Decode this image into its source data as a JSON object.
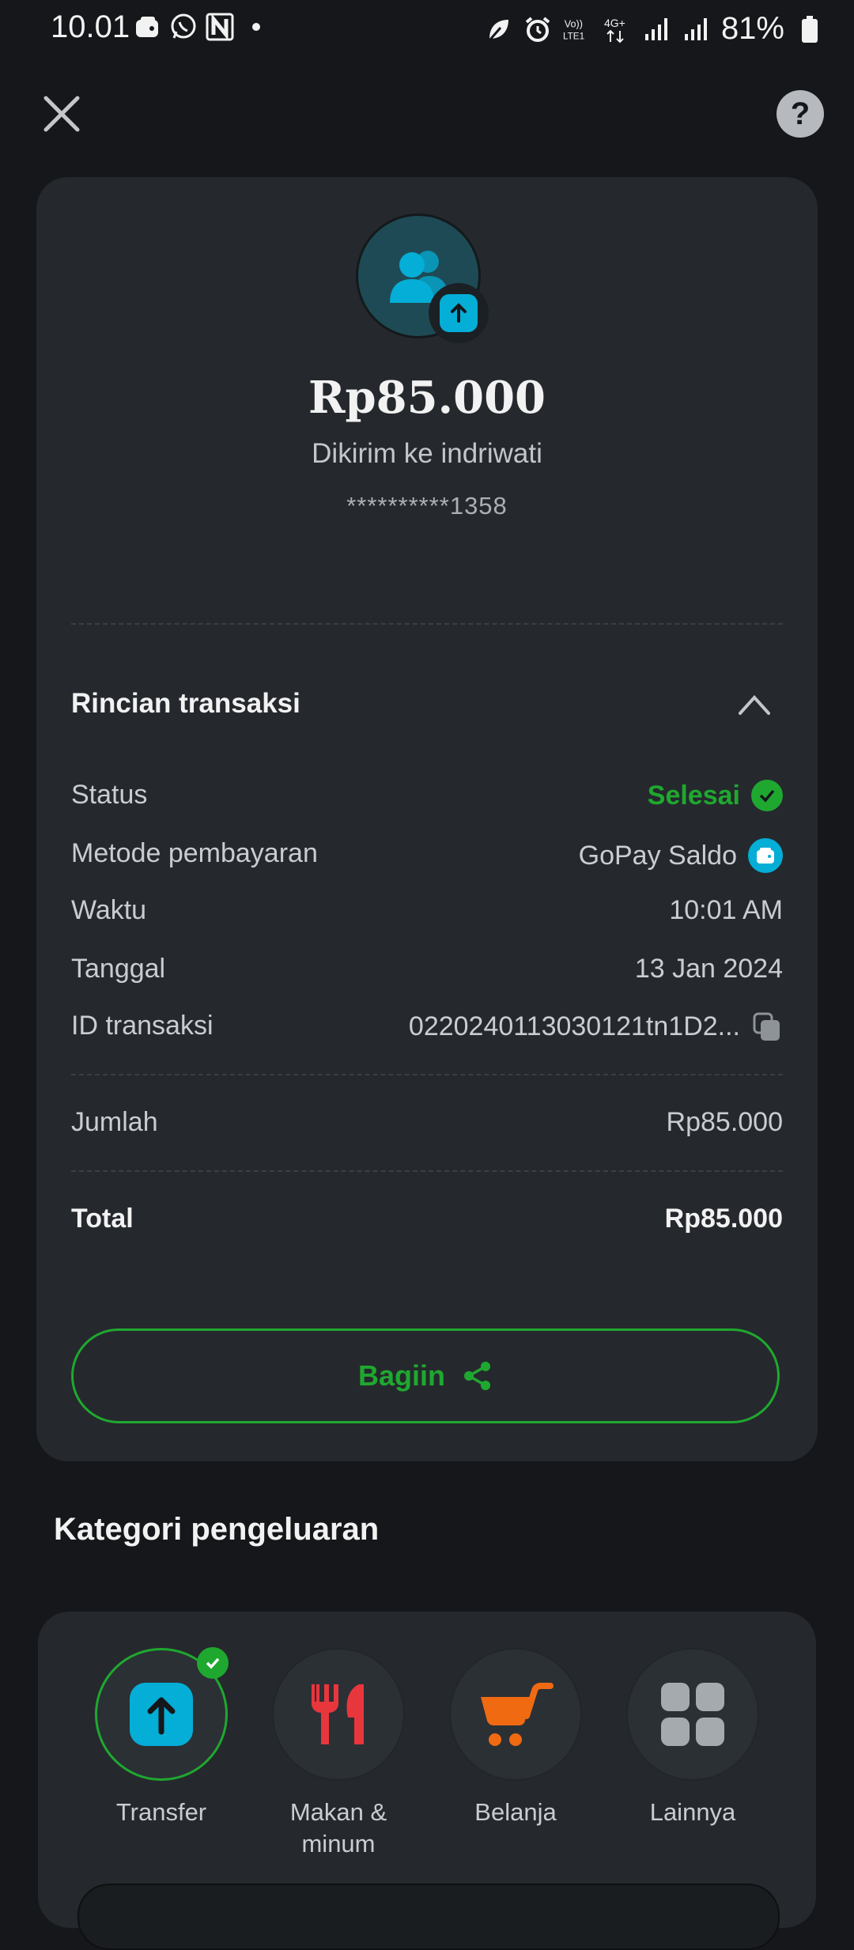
{
  "status_bar": {
    "time": "10.01",
    "battery": "81%",
    "icons": [
      "wallet-icon",
      "whatsapp-icon",
      "n-app-icon",
      "dot-icon",
      "leaf-icon",
      "alarm-icon",
      "volte-icon",
      "4g-icon",
      "signal-icon",
      "signal-icon",
      "battery-icon"
    ]
  },
  "header": {
    "close_icon": "close-icon",
    "help_label": "?"
  },
  "summary": {
    "amount": "Rp85.000",
    "sent_to": "Dikirim ke indriwati",
    "account": "**********1358"
  },
  "details": {
    "title": "Rincian transaksi",
    "rows": {
      "status": {
        "label": "Status",
        "value": "Selesai"
      },
      "method": {
        "label": "Metode pembayaran",
        "value": "GoPay Saldo"
      },
      "time": {
        "label": "Waktu",
        "value": "10:01 AM"
      },
      "date": {
        "label": "Tanggal",
        "value": "13 Jan 2024"
      },
      "txid": {
        "label": "ID transaksi",
        "value": "0220240113030121tn1D2..."
      }
    },
    "jumlah": {
      "label": "Jumlah",
      "value": "Rp85.000"
    },
    "total": {
      "label": "Total",
      "value": "Rp85.000"
    }
  },
  "share_button": {
    "label": "Bagiin"
  },
  "categories": {
    "title": "Kategori pengeluaran",
    "items": [
      {
        "label": "Transfer",
        "selected": true
      },
      {
        "label": "Makan & minum",
        "selected": false
      },
      {
        "label": "Belanja",
        "selected": false
      },
      {
        "label": "Lainnya",
        "selected": false
      }
    ]
  },
  "colors": {
    "background": "#15171a",
    "card": "#25292d",
    "accent_green": "#1fa82f",
    "accent_blue": "#04aed6",
    "food_red": "#e8363d",
    "shop_orange": "#f06a12"
  }
}
